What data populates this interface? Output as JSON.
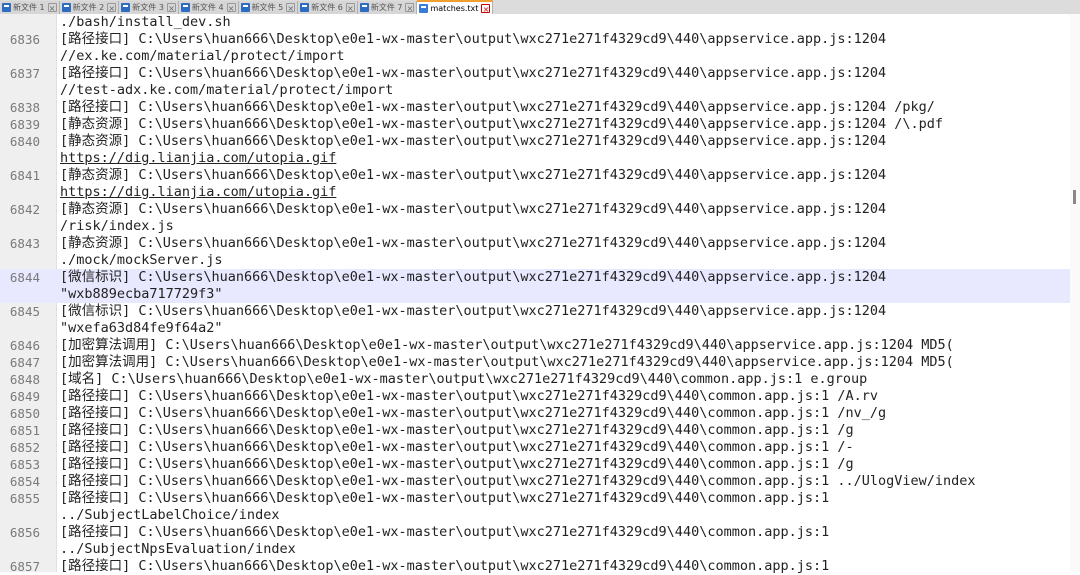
{
  "tabs": [
    {
      "label": "新文件 1"
    },
    {
      "label": "新文件 2"
    },
    {
      "label": "新文件 3"
    },
    {
      "label": "新文件 4"
    },
    {
      "label": "新文件 5"
    },
    {
      "label": "新文件 6"
    },
    {
      "label": "新文件 7"
    },
    {
      "label": "matches.txt",
      "active": true
    }
  ],
  "lines": [
    {
      "num": "",
      "text": "./bash/install_dev.sh"
    },
    {
      "num": "6836",
      "text": "[路径接口] C:\\Users\\huan666\\Desktop\\e0e1-wx-master\\output\\wxc271e271f4329cd9\\440\\appservice.app.js:1204"
    },
    {
      "num": "",
      "text": "//ex.ke.com/material/protect/import"
    },
    {
      "num": "6837",
      "text": "[路径接口] C:\\Users\\huan666\\Desktop\\e0e1-wx-master\\output\\wxc271e271f4329cd9\\440\\appservice.app.js:1204"
    },
    {
      "num": "",
      "text": "//test-adx.ke.com/material/protect/import"
    },
    {
      "num": "6838",
      "text": "[路径接口] C:\\Users\\huan666\\Desktop\\e0e1-wx-master\\output\\wxc271e271f4329cd9\\440\\appservice.app.js:1204 /pkg/"
    },
    {
      "num": "6839",
      "text": "[静态资源] C:\\Users\\huan666\\Desktop\\e0e1-wx-master\\output\\wxc271e271f4329cd9\\440\\appservice.app.js:1204 /\\.pdf"
    },
    {
      "num": "6840",
      "text": "[静态资源] C:\\Users\\huan666\\Desktop\\e0e1-wx-master\\output\\wxc271e271f4329cd9\\440\\appservice.app.js:1204"
    },
    {
      "num": "",
      "text": "https://dig.lianjia.com/utopia.gif",
      "url": true
    },
    {
      "num": "6841",
      "text": "[静态资源] C:\\Users\\huan666\\Desktop\\e0e1-wx-master\\output\\wxc271e271f4329cd9\\440\\appservice.app.js:1204"
    },
    {
      "num": "",
      "text": "https://dig.lianjia.com/utopia.gif",
      "url": true
    },
    {
      "num": "6842",
      "text": "[静态资源] C:\\Users\\huan666\\Desktop\\e0e1-wx-master\\output\\wxc271e271f4329cd9\\440\\appservice.app.js:1204"
    },
    {
      "num": "",
      "text": "/risk/index.js"
    },
    {
      "num": "6843",
      "text": "[静态资源] C:\\Users\\huan666\\Desktop\\e0e1-wx-master\\output\\wxc271e271f4329cd9\\440\\appservice.app.js:1204"
    },
    {
      "num": "",
      "text": "./mock/mockServer.js"
    },
    {
      "num": "6844",
      "text": "[微信标识] C:\\Users\\huan666\\Desktop\\e0e1-wx-master\\output\\wxc271e271f4329cd9\\440\\appservice.app.js:1204",
      "hl": true
    },
    {
      "num": "",
      "text": "\"wxb889ecba717729f3\"",
      "hl": true
    },
    {
      "num": "6845",
      "text": "[微信标识] C:\\Users\\huan666\\Desktop\\e0e1-wx-master\\output\\wxc271e271f4329cd9\\440\\appservice.app.js:1204"
    },
    {
      "num": "",
      "text": "\"wxefa63d84fe9f64a2\""
    },
    {
      "num": "6846",
      "text": "[加密算法调用] C:\\Users\\huan666\\Desktop\\e0e1-wx-master\\output\\wxc271e271f4329cd9\\440\\appservice.app.js:1204 MD5("
    },
    {
      "num": "6847",
      "text": "[加密算法调用] C:\\Users\\huan666\\Desktop\\e0e1-wx-master\\output\\wxc271e271f4329cd9\\440\\appservice.app.js:1204 MD5("
    },
    {
      "num": "6848",
      "text": "[域名] C:\\Users\\huan666\\Desktop\\e0e1-wx-master\\output\\wxc271e271f4329cd9\\440\\common.app.js:1 e.group"
    },
    {
      "num": "6849",
      "text": "[路径接口] C:\\Users\\huan666\\Desktop\\e0e1-wx-master\\output\\wxc271e271f4329cd9\\440\\common.app.js:1 /A.rv"
    },
    {
      "num": "6850",
      "text": "[路径接口] C:\\Users\\huan666\\Desktop\\e0e1-wx-master\\output\\wxc271e271f4329cd9\\440\\common.app.js:1 /nv_/g"
    },
    {
      "num": "6851",
      "text": "[路径接口] C:\\Users\\huan666\\Desktop\\e0e1-wx-master\\output\\wxc271e271f4329cd9\\440\\common.app.js:1 /g"
    },
    {
      "num": "6852",
      "text": "[路径接口] C:\\Users\\huan666\\Desktop\\e0e1-wx-master\\output\\wxc271e271f4329cd9\\440\\common.app.js:1 /-"
    },
    {
      "num": "6853",
      "text": "[路径接口] C:\\Users\\huan666\\Desktop\\e0e1-wx-master\\output\\wxc271e271f4329cd9\\440\\common.app.js:1 /g"
    },
    {
      "num": "6854",
      "text": "[路径接口] C:\\Users\\huan666\\Desktop\\e0e1-wx-master\\output\\wxc271e271f4329cd9\\440\\common.app.js:1 ../UlogView/index"
    },
    {
      "num": "6855",
      "text": "[路径接口] C:\\Users\\huan666\\Desktop\\e0e1-wx-master\\output\\wxc271e271f4329cd9\\440\\common.app.js:1"
    },
    {
      "num": "",
      "text": "../SubjectLabelChoice/index"
    },
    {
      "num": "6856",
      "text": "[路径接口] C:\\Users\\huan666\\Desktop\\e0e1-wx-master\\output\\wxc271e271f4329cd9\\440\\common.app.js:1"
    },
    {
      "num": "",
      "text": "../SubjectNpsEvaluation/index"
    },
    {
      "num": "6857",
      "text": "[路径接口] C:\\Users\\huan666\\Desktop\\e0e1-wx-master\\output\\wxc271e271f4329cd9\\440\\common.app.js:1"
    }
  ]
}
